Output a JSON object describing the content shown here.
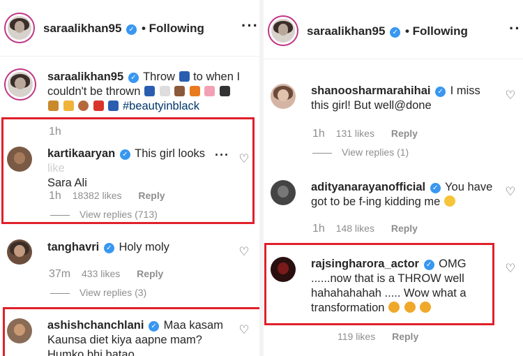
{
  "left": {
    "header": {
      "username": "saraalikhan95",
      "follow": "• Following"
    },
    "caption": {
      "username": "saraalikhan95",
      "text_1": "Throw",
      "text_2": "to when I",
      "text_3": "couldn't be thrown",
      "hashtag": "#beautyinblack",
      "time": "1h"
    },
    "comments": [
      {
        "username": "kartikaaryan",
        "text_1": "This girl looks",
        "text_faded": "like",
        "text_2": "Sara Ali",
        "time": "1h",
        "likes": "18382 likes",
        "reply": "Reply",
        "replies": "View replies (713)"
      },
      {
        "username": "tanghavri",
        "text_1": "Holy moly",
        "time": "37m",
        "likes": "433 likes",
        "reply": "Reply",
        "replies": "View replies (3)"
      },
      {
        "username": "ashishchanchlani",
        "text_1": "Maa kasam",
        "text_2": "Kaunsa diet kiya aapne mam?",
        "text_3": "Humko bhi batao"
      }
    ]
  },
  "right": {
    "header": {
      "username": "saraalikhan95",
      "follow": "• Following"
    },
    "comments": [
      {
        "username": "shanoosharmarahihai",
        "text_1": "I miss",
        "text_2": "this girl! But well@done",
        "time": "1h",
        "likes": "131 likes",
        "reply": "Reply",
        "replies": "View replies (1)"
      },
      {
        "username": "adityanarayanofficial",
        "text_1": "You have",
        "text_2": "got to be f-ing kidding me",
        "time": "1h",
        "likes": "148 likes",
        "reply": "Reply"
      },
      {
        "username": "rajsingharora_actor",
        "text_1": "OMG",
        "text_2": "......now that is a THROW well",
        "text_3": "hahahahahah ..... Wow what a",
        "text_4": "transformation",
        "likes": "119 likes",
        "reply": "Reply"
      }
    ]
  },
  "colors": {
    "highlight": "#e0202a",
    "verified": "#3897f0",
    "meta": "#8e8e8e"
  }
}
